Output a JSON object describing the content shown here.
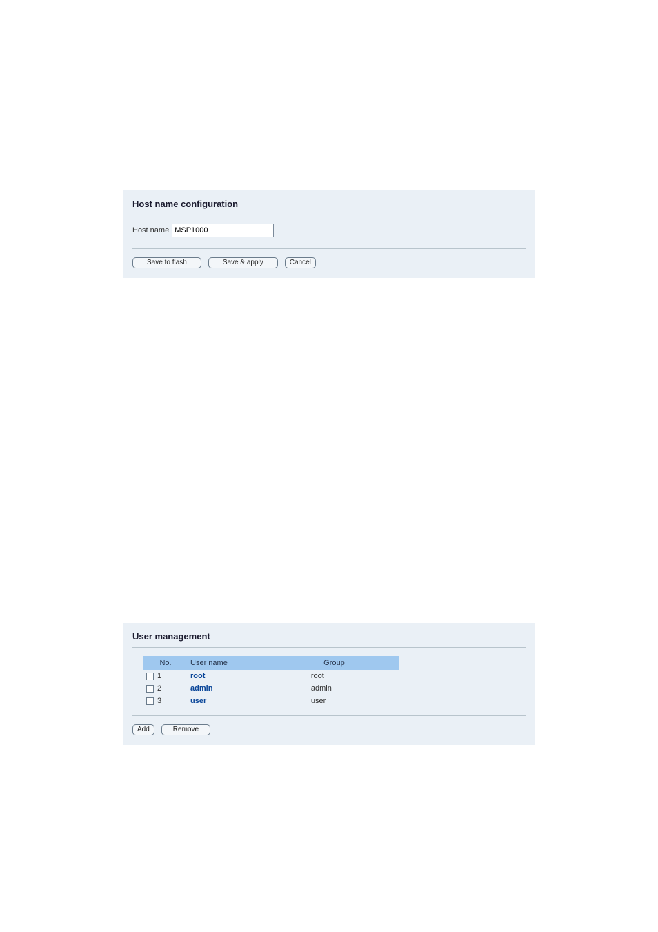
{
  "hostPanel": {
    "title": "Host name configuration",
    "label": "Host name",
    "value": "MSP1000",
    "buttons": {
      "saveFlash": "Save to flash",
      "saveApply": "Save & apply",
      "cancel": "Cancel"
    }
  },
  "userPanel": {
    "title": "User management",
    "columns": {
      "no": "No.",
      "user": "User name",
      "group": "Group"
    },
    "rows": [
      {
        "no": "1",
        "user": "root",
        "group": "root"
      },
      {
        "no": "2",
        "user": "admin",
        "group": "admin"
      },
      {
        "no": "3",
        "user": "user",
        "group": "user"
      }
    ],
    "buttons": {
      "add": "Add",
      "remove": "Remove"
    }
  }
}
